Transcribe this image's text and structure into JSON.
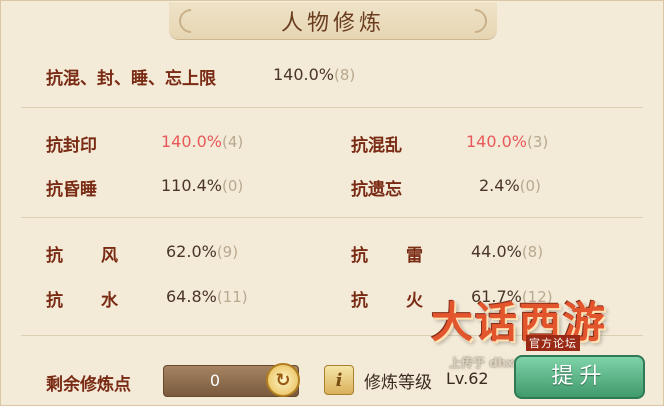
{
  "title": "人物修炼",
  "seal_row": {
    "label": "抗混、封、睡、忘上限",
    "value": "140.0%",
    "count": "(8)"
  },
  "group1": [
    {
      "label": "抗封印",
      "value": "140.0%",
      "count": "(4)",
      "highlight": true
    },
    {
      "label": "抗混乱",
      "value": "140.0%",
      "count": "(3)",
      "highlight": true
    },
    {
      "label": "抗昏睡",
      "value": "110.4%",
      "count": "(0)",
      "highlight": false
    },
    {
      "label": "抗遗忘",
      "value": "2.4%",
      "count": "(0)",
      "highlight": false
    }
  ],
  "group2": [
    {
      "label_a": "抗",
      "label_b": "风",
      "value": "62.0%",
      "count": "(9)"
    },
    {
      "label_a": "抗",
      "label_b": "雷",
      "value": "44.0%",
      "count": "(8)"
    },
    {
      "label_a": "抗",
      "label_b": "水",
      "value": "64.8%",
      "count": "(11)"
    },
    {
      "label_a": "抗",
      "label_b": "火",
      "value": "61.7%",
      "count": "(12)"
    }
  ],
  "footer": {
    "points_label": "剩余修炼点",
    "points_value": "0",
    "refresh_glyph": "↻",
    "info_glyph": "i",
    "level_label": "修炼等级",
    "level_value": "Lv.62",
    "upgrade_label": "提升"
  },
  "logo": {
    "main": "大话西游",
    "sub": "官方论坛",
    "watermark": "上传于 dhxy.netease.com"
  },
  "colors": {
    "label": "#7a2b14",
    "highlight": "#e85a5a",
    "button": "#3f9a6c"
  }
}
